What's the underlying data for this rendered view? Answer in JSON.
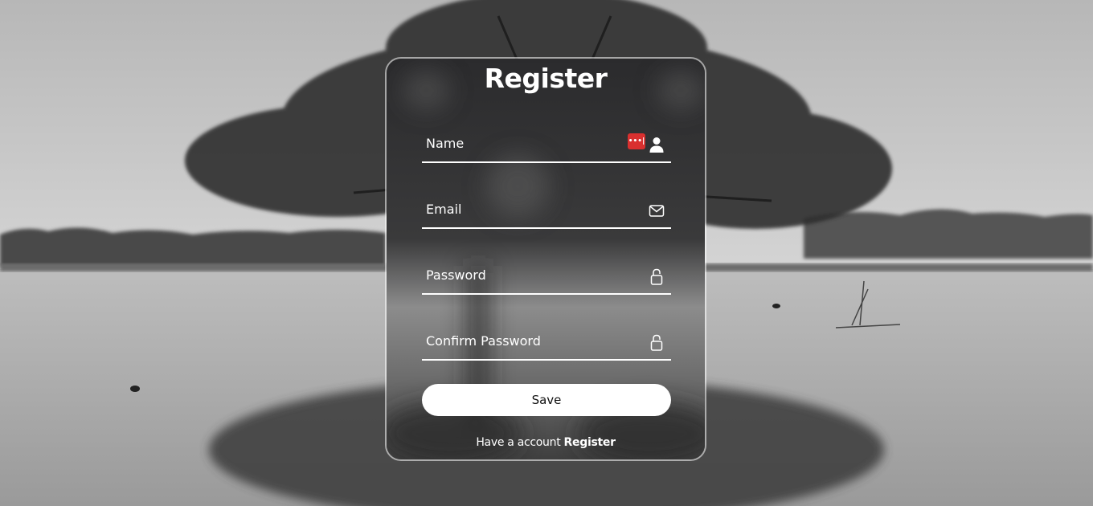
{
  "form": {
    "title": "Register",
    "fields": [
      {
        "placeholder": "Name",
        "value": "",
        "icon": "person-icon"
      },
      {
        "placeholder": "Email",
        "value": "",
        "icon": "mail-icon"
      },
      {
        "placeholder": "Password",
        "value": "",
        "icon": "lock-icon"
      },
      {
        "placeholder": "Confirm Password",
        "value": "",
        "icon": "lock-icon"
      }
    ],
    "password_manager_badge": "•••|",
    "save_label": "Save",
    "footer_text": "Have a account",
    "footer_link": "Register"
  },
  "colors": {
    "accent": "#ffffff",
    "badge": "#d9302f",
    "button_text": "#111111"
  }
}
